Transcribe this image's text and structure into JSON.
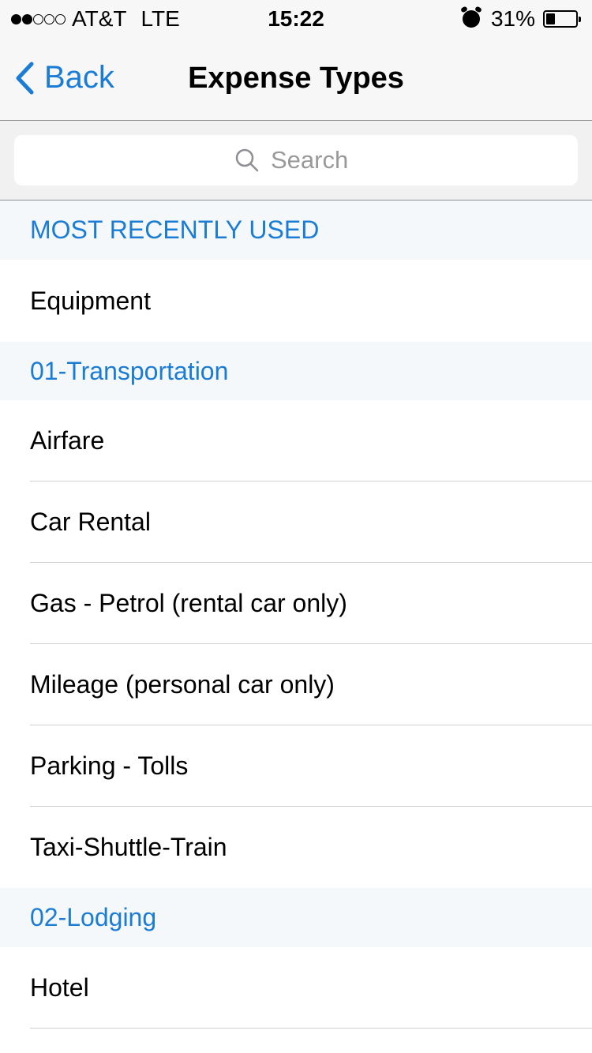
{
  "status_bar": {
    "carrier": "AT&T",
    "network": "LTE",
    "time": "15:22",
    "battery_percent": "31%",
    "battery_level": 0.31,
    "signal_bars_filled": 2,
    "signal_bars_total": 5
  },
  "nav": {
    "back_label": "Back",
    "title": "Expense Types"
  },
  "search": {
    "placeholder": "Search"
  },
  "sections": [
    {
      "header": "MOST RECENTLY USED",
      "items": [
        "Equipment"
      ]
    },
    {
      "header": "01-Transportation",
      "items": [
        "Airfare",
        "Car Rental",
        "Gas - Petrol (rental car only)",
        "Mileage (personal car only)",
        "Parking - Tolls",
        "Taxi-Shuttle-Train"
      ]
    },
    {
      "header": "02-Lodging",
      "items": [
        "Hotel"
      ]
    }
  ],
  "colors": {
    "accent": "#1b7cd6",
    "section_header_bg": "#f5f8fb"
  },
  "icons": [
    "chevron-left-icon",
    "search-icon",
    "alarm-icon",
    "battery-icon",
    "signal-dots-icon"
  ]
}
